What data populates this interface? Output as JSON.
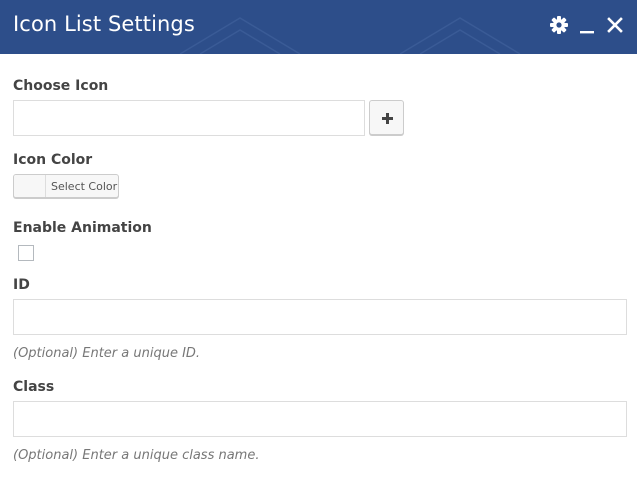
{
  "header": {
    "title": "Icon List Settings",
    "bg_color": "#2d4e8a",
    "icons": [
      "gear-icon",
      "minimize-icon",
      "close-icon"
    ]
  },
  "fields": {
    "choose_icon": {
      "label": "Choose Icon",
      "value": "",
      "add_button_icon": "plus-icon"
    },
    "icon_color": {
      "label": "Icon Color",
      "button_label": "Select Color"
    },
    "enable_animation": {
      "label": "Enable Animation",
      "checked": false
    },
    "id": {
      "label": "ID",
      "value": "",
      "help": "(Optional) Enter a unique ID."
    },
    "class": {
      "label": "Class",
      "value": "",
      "help": "(Optional) Enter a unique class name."
    }
  }
}
